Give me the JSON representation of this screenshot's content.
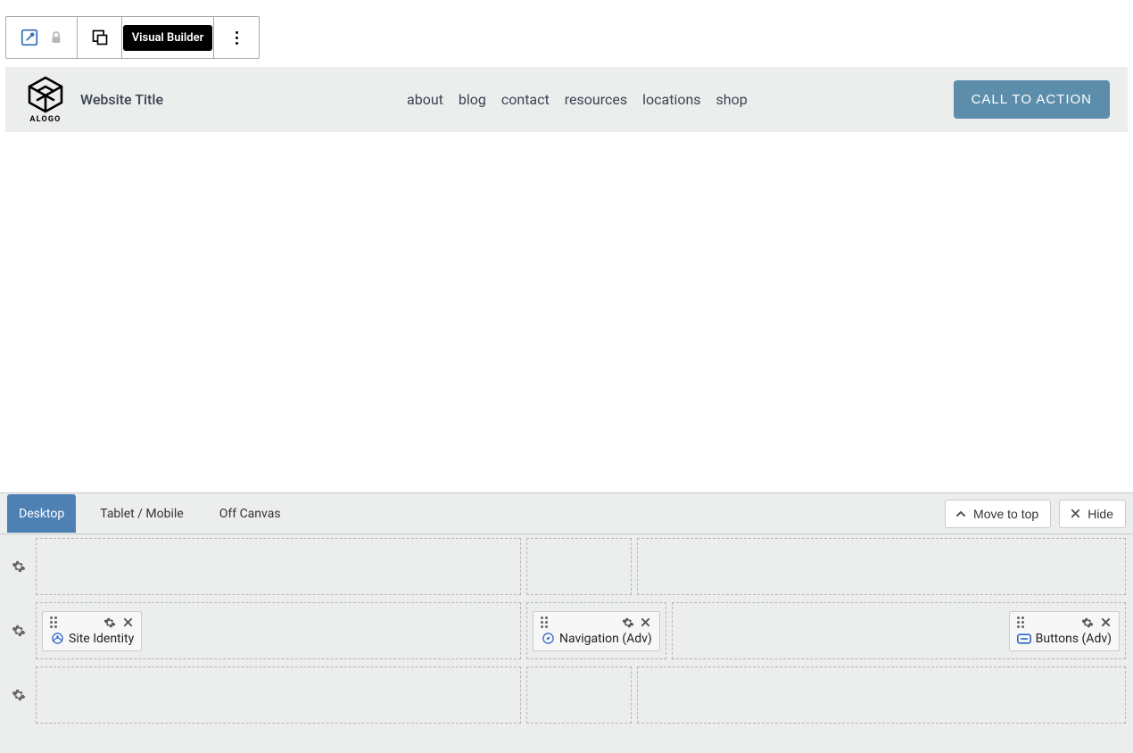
{
  "toolbar": {
    "visual_builder_label": "Visual Builder"
  },
  "site": {
    "logo_text": "ALOGO",
    "title": "Website Title",
    "nav": [
      "about",
      "blog",
      "contact",
      "resources",
      "locations",
      "shop"
    ],
    "cta_label": "CALL TO ACTION"
  },
  "builder": {
    "tabs": [
      "Desktop",
      "Tablet / Mobile",
      "Off Canvas"
    ],
    "active_tab_index": 0,
    "actions": {
      "move_top": "Move to top",
      "hide": "Hide"
    },
    "widgets": {
      "site_identity": "Site Identity",
      "navigation_adv": "Navigation (Adv)",
      "buttons_adv": "Buttons (Adv)"
    }
  }
}
